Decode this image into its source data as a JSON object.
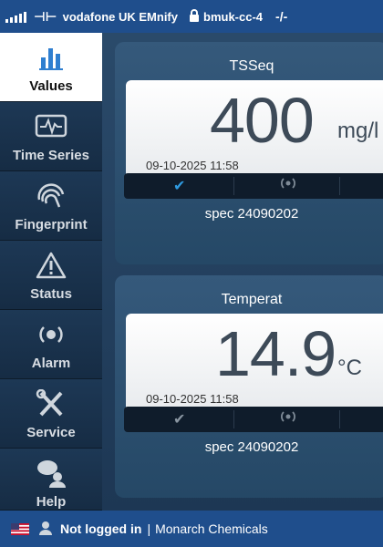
{
  "status_bar": {
    "carrier": "vodafone UK EMnify",
    "device": "bmuk-cc-4",
    "signal_icon": "signal-bars-icon",
    "lock_icon": "lock-icon",
    "link_icon": "disconnected-icon"
  },
  "sidebar": {
    "items": [
      {
        "label": "Values",
        "icon": "bar-chart-icon",
        "active": true
      },
      {
        "label": "Time Series",
        "icon": "waveform-monitor-icon",
        "active": false
      },
      {
        "label": "Fingerprint",
        "icon": "fingerprint-icon",
        "active": false
      },
      {
        "label": "Status",
        "icon": "warning-icon",
        "active": false
      },
      {
        "label": "Alarm",
        "icon": "alarm-broadcast-icon",
        "active": false
      },
      {
        "label": "Service",
        "icon": "wrench-screwdriver-icon",
        "active": false
      },
      {
        "label": "Help",
        "icon": "help-user-icon",
        "active": false
      }
    ]
  },
  "measurements": [
    {
      "title": "TSSeq",
      "value": "400",
      "unit": "mg/l",
      "timestamp": "09-10-2025 11:58",
      "spec": "spec 24090202",
      "status_icons": [
        "check-icon",
        "broadcast-icon"
      ],
      "check_color": "#2f9be0"
    },
    {
      "title": "Temperat",
      "value": "14.9",
      "unit": "°C",
      "timestamp": "09-10-2025 11:58",
      "spec": "spec 24090202",
      "status_icons": [
        "check-icon",
        "broadcast-icon"
      ],
      "check_color": "#8a96a2"
    }
  ],
  "footer": {
    "flag_icon": "us-flag-icon",
    "user_icon": "user-icon",
    "login_status": "Not logged in",
    "separator": "|",
    "company": "Monarch Chemicals"
  },
  "colors": {
    "bar_blue": "#1f4e8c",
    "nav_bg": "#1d3855",
    "card_bg": "#35597b",
    "value_text": "#3d4a58"
  }
}
